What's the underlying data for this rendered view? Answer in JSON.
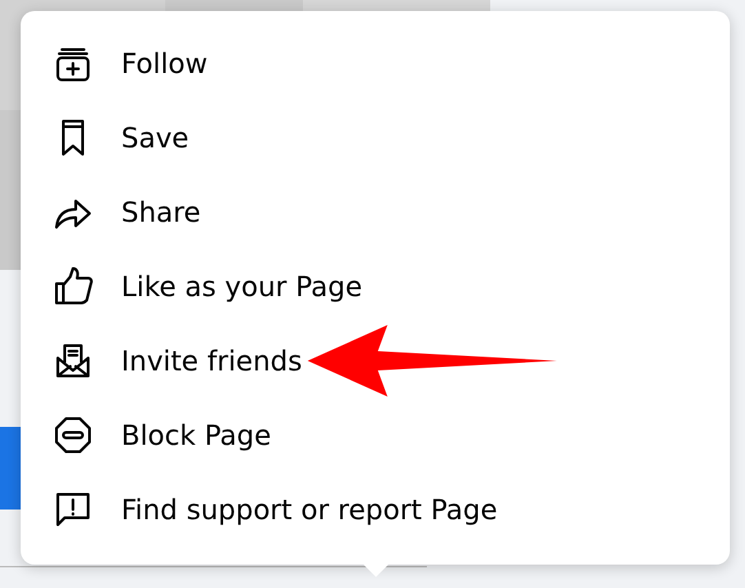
{
  "menu": {
    "items": [
      {
        "label": "Follow",
        "callout_arrow": false
      },
      {
        "label": "Save",
        "callout_arrow": false
      },
      {
        "label": "Share",
        "callout_arrow": false
      },
      {
        "label": "Like as your Page",
        "callout_arrow": false
      },
      {
        "label": "Invite friends",
        "callout_arrow": true
      },
      {
        "label": "Block Page",
        "callout_arrow": false
      },
      {
        "label": "Find support or report Page",
        "callout_arrow": false
      }
    ]
  }
}
